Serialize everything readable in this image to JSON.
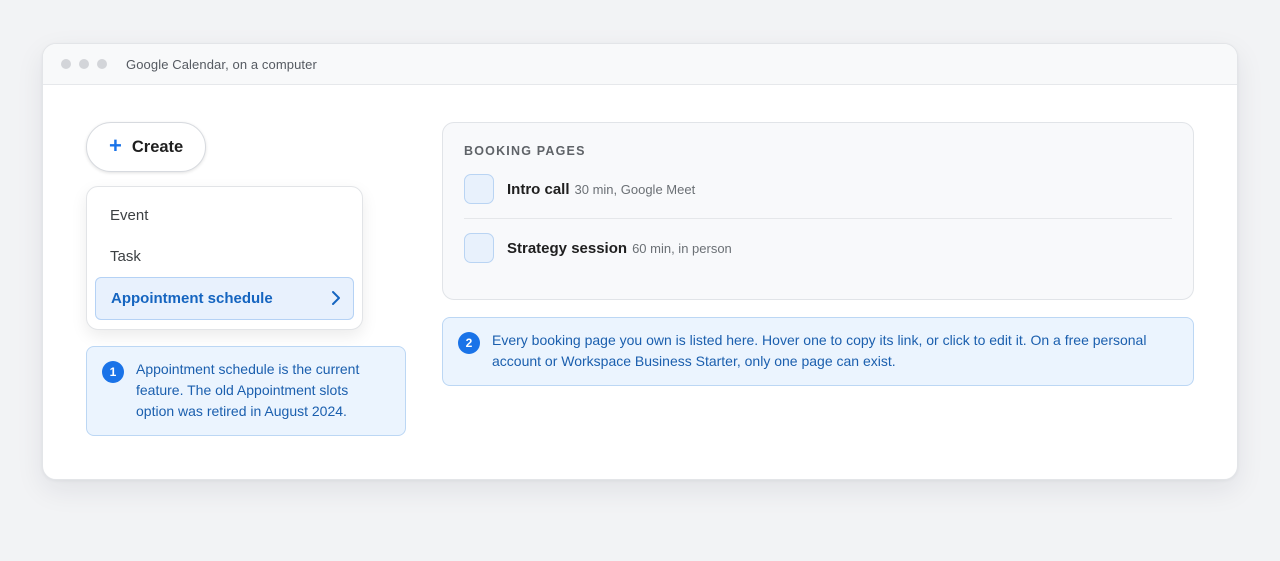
{
  "window": {
    "title": "Google Calendar, on a computer"
  },
  "create_button": {
    "icon": "plus-icon",
    "label": "Create"
  },
  "create_menu": {
    "items": [
      {
        "label": "Event"
      },
      {
        "label": "Task"
      },
      {
        "label": "Appointment schedule",
        "selected": true,
        "icon": "chevron-right-icon"
      }
    ]
  },
  "notes": [
    {
      "number": "1",
      "text": "Appointment schedule is the current feature. The old Appointment slots option was retired in August 2024."
    },
    {
      "number": "2",
      "text": "Every booking page you own is listed here. Hover one to copy its link, or click to edit it. On a free personal account or Workspace Business Starter, only one page can exist."
    }
  ],
  "booking_pages": {
    "heading": "BOOKING PAGES",
    "items": [
      {
        "title": "Intro call",
        "meta": "30 min, Google Meet"
      },
      {
        "title": "Strategy session",
        "meta": "60 min, in person"
      }
    ]
  },
  "colors": {
    "accent": "#1a73e8",
    "note_background": "#ebf4fe",
    "note_text": "#1b5fae",
    "selected_background": "#e8f1fd"
  }
}
